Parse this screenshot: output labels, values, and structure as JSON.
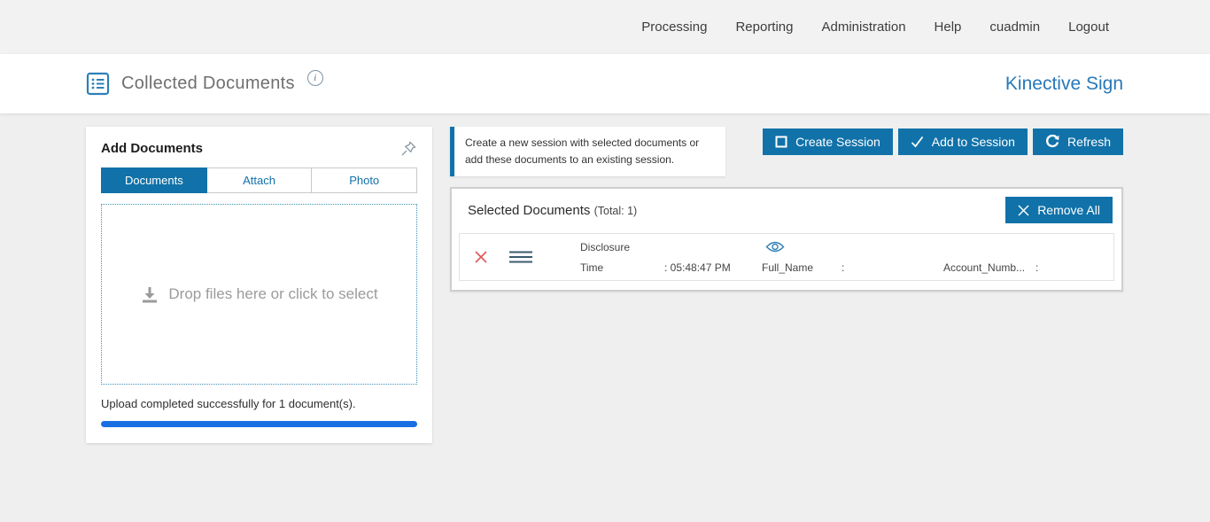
{
  "colors": {
    "primary_blue": "#1172A9",
    "brand_blue": "#2878B8",
    "progress_blue": "#1A6FE3",
    "remove_red": "#E25555",
    "icon_blue": "#2D7FB8"
  },
  "nav": {
    "items": [
      "Processing",
      "Reporting",
      "Administration",
      "Help",
      "cuadmin",
      "Logout"
    ]
  },
  "header": {
    "title": "Collected Documents",
    "info_icon": "i",
    "brand": "Kinective Sign"
  },
  "add_documents": {
    "title": "Add Documents",
    "tabs": [
      "Documents",
      "Attach",
      "Photo"
    ],
    "active_tab": "Documents",
    "dropzone_text": "Drop files here or click to select",
    "upload_status": "Upload completed successfully for 1 document(s)."
  },
  "session_banner": {
    "text": "Create a new session with selected documents or add these documents to an existing session."
  },
  "actions": {
    "create_session": "Create Session",
    "add_to_session": "Add to Session",
    "refresh": "Refresh"
  },
  "selected_documents": {
    "title": "Selected Documents",
    "total": "(Total: 1)",
    "remove_all": "Remove All",
    "rows": [
      {
        "name": "Disclosure",
        "time_label": "Time",
        "time_value": ": 05:48:47 PM",
        "full_name_label": "Full_Name",
        "full_name_colon": ":",
        "account_label": "Account_Numb...",
        "account_colon": ":"
      }
    ]
  }
}
